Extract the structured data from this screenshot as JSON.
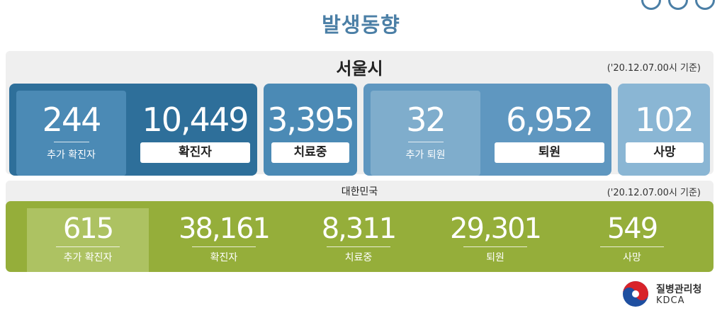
{
  "page_title": "발생동향",
  "seoul": {
    "title": "서울시",
    "date": "('20.12.07.00시 기준)",
    "additional_confirmed": "244",
    "additional_confirmed_label": "추가 확진자",
    "confirmed": "10,449",
    "confirmed_label": "확진자",
    "in_treatment": "3,395",
    "in_treatment_label": "치료중",
    "additional_discharged": "32",
    "additional_discharged_label": "추가 퇴원",
    "discharged": "6,952",
    "discharged_label": "퇴원",
    "deaths": "102",
    "deaths_label": "사망"
  },
  "korea": {
    "title": "대한민국",
    "date": "('20.12.07.00시 기준)",
    "stats": [
      {
        "value": "615",
        "label": "추가 확진자"
      },
      {
        "value": "38,161",
        "label": "확진자"
      },
      {
        "value": "8,311",
        "label": "치료중"
      },
      {
        "value": "29,301",
        "label": "퇴원"
      },
      {
        "value": "549",
        "label": "사망"
      }
    ]
  },
  "logo": {
    "name": "질병관리청",
    "abbr": "KDCA"
  },
  "colors": {
    "title": "#4b7fa6",
    "card_dark": "#2e6f9a",
    "card_mid": "#4b8ab5",
    "card_light": "#5f97c0",
    "card_lighter": "#8ab6d4",
    "korea_green": "#95ae3a"
  }
}
